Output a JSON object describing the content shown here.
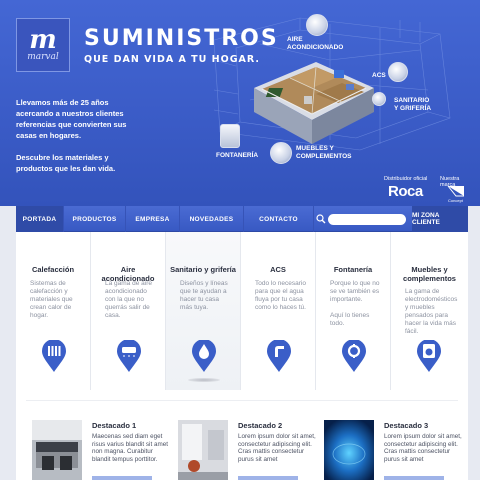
{
  "brand": {
    "logo_mark": "m",
    "logo_text": "marval",
    "title": "SUMINISTROS",
    "subtitle": "QUE DAN VIDA A TU HOGAR."
  },
  "hero": {
    "intro": "Llevamos más de 25 años acercando a nuestros clientes referencias que convierten sus casas en hogares.",
    "intro2": "Descubre los materiales y productos que les dan vida.",
    "labels": {
      "aire": "AIRE\nACONDICIONADO",
      "acs": "ACS",
      "sanitario": "SANITARIO\nY GRIFERÍA",
      "muebles": "MUEBLES Y\nCOMPLEMENTOS",
      "fontaneria": "FONTANERÍA"
    },
    "distributor_label": "Distribuidor oficial",
    "distributor_brand": "Roca",
    "nuestra_marca": "Nuestra marca",
    "concept_label": "Concept"
  },
  "nav": {
    "items": [
      "PORTADA",
      "PRODUCTOS",
      "EMPRESA",
      "NOVEDADES",
      "CONTACTO"
    ],
    "search_placeholder": "",
    "zona": "MI ZONA CLIENTE"
  },
  "categories": [
    {
      "title": "Calefacción",
      "desc": "Sistemas de calefacción y materiales que crean calor de hogar.",
      "icon": "radiator-icon"
    },
    {
      "title": "Aire acondicionado",
      "desc": "La gama de aire acondicionado con la que no querrás salir de casa.",
      "icon": "air-conditioner-icon"
    },
    {
      "title": "Sanitario y grifería",
      "desc": "Diseños y líneas que te ayudan a hacer tu casa más tuya.",
      "icon": "water-drop-icon"
    },
    {
      "title": "ACS",
      "desc": "Todo lo necesario para que el agua fluya por tu casa como lo haces tú.",
      "icon": "faucet-icon"
    },
    {
      "title": "Fontanería",
      "desc": "Porque lo que no se ve también es importante.\n\nAquí lo tienes todo.",
      "icon": "pipe-fitting-icon"
    },
    {
      "title": "Muebles y complementos",
      "desc": "La gama de electrodomésticos y muebles pensados para hacer la vida más fácil.",
      "icon": "washing-machine-icon"
    }
  ],
  "featured": [
    {
      "title": "Destacado 1",
      "text": "Maecenas sed diam eget risus varius blandit sit amet non magna. Curabitur blandit tempus porttitor."
    },
    {
      "title": "Destacado 2",
      "text": "Lorem ipsum dolor sit amet, consectetur adipiscing elit. Cras mattis consectetur purus sit amet"
    },
    {
      "title": "Destacado 3",
      "text": "Lorem ipsum dolor sit amet, consectetur adipiscing elit. Cras mattis consectetur purus sit amet"
    }
  ],
  "colors": {
    "hero_blue": "#3a5bc6",
    "nav_active": "#2f4ba7",
    "pin_blue": "#3a5ec8"
  }
}
